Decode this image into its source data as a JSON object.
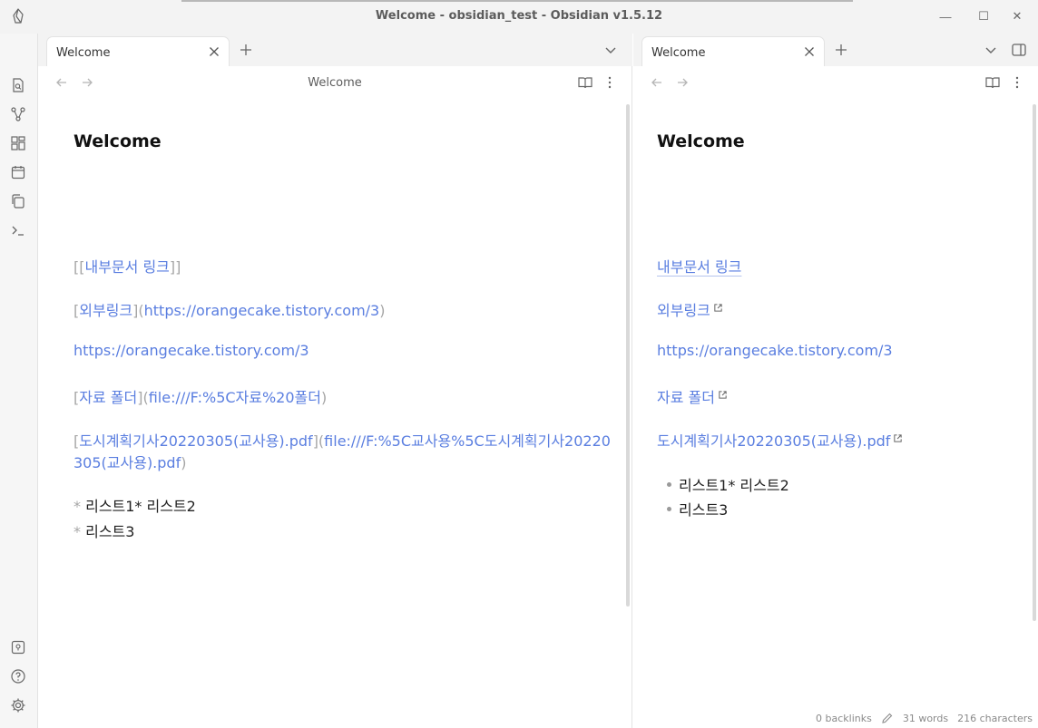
{
  "window": {
    "title": "Welcome - obsidian_test - Obsidian v1.5.12",
    "controls": {
      "minimize": "—",
      "maximize": "☐",
      "close": "✕"
    }
  },
  "ribbon": {
    "top_icons": [
      "file-search-icon",
      "graph-icon",
      "canvas-icon",
      "calendar-icon",
      "copy-icon",
      "terminal-icon"
    ],
    "bottom_icons": [
      "vault-icon",
      "help-icon",
      "settings-icon"
    ]
  },
  "left_pane": {
    "tab_label": "Welcome",
    "view_title": "Welcome",
    "heading": "Welcome",
    "lines": {
      "internal_link": {
        "open": "[[",
        "text": "내부문서 링크",
        "close": "]]"
      },
      "external_link": {
        "open": "[",
        "text": "외부링크",
        "mid": "](",
        "url": "https://orangecake.tistory.com/3",
        "close": ")"
      },
      "bare_url": "https://orangecake.tistory.com/3",
      "folder_link": {
        "open": "[",
        "text": "자료 폴더",
        "mid": "](",
        "url": "file:///F:%5C자료%20폴더",
        "close": ")"
      },
      "pdf_link": {
        "open": "[",
        "text": "도시계획기사20220305(교사용).pdf",
        "mid": "](",
        "url_line1": "file:///F:%5C교사용%5C도시계획기사20220",
        "url_line2": "305(교사용).pdf",
        "close": ")"
      },
      "list_marker": "*",
      "list_line1": "리스트1* 리스트2",
      "list_line2": "리스트3"
    }
  },
  "right_pane": {
    "tab_label": "Welcome",
    "heading": "Welcome",
    "internal_link": "내부문서 링크",
    "external_link": "외부링크",
    "bare_url": "https://orangecake.tistory.com/3",
    "folder_link": "자료 폴더",
    "pdf_link": "도시계획기사20220305(교사용).pdf",
    "list_items": [
      "리스트1* 리스트2",
      "리스트3"
    ]
  },
  "status": {
    "backlinks": "0 backlinks",
    "words": "31 words",
    "characters": "216 characters"
  },
  "colors": {
    "link": "#5a7ee0",
    "muted": "#a6a6a6",
    "chrome": "#f3f3f3"
  }
}
